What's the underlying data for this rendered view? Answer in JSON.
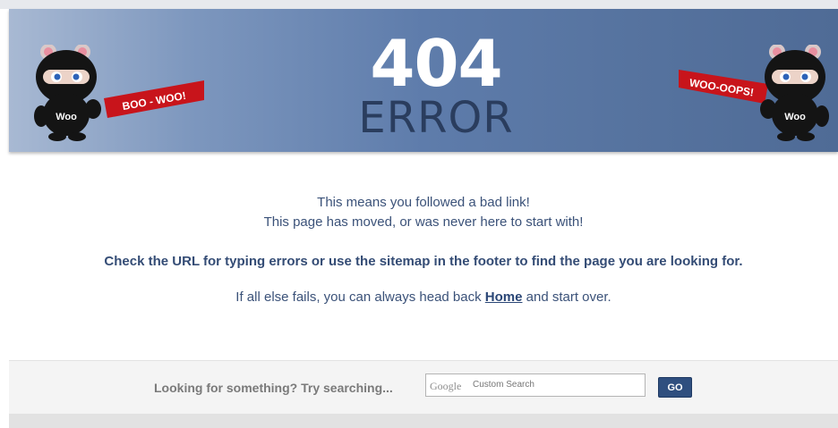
{
  "banner": {
    "title_number": "404",
    "title_word": "ERROR",
    "left_ribbon": "BOO - WOO!",
    "right_ribbon": "WOO-OOPS!",
    "mascot_label": "Woo"
  },
  "message": {
    "line1": "This means you followed a bad link!",
    "line2": "This page has moved, or was never here to start with!",
    "line3": "Check the URL for typing errors or use the sitemap in the footer to find the page you are looking for.",
    "line4_before": "If all else fails, you can always head back ",
    "home_link": "Home",
    "line4_after": " and start over."
  },
  "search": {
    "label": "Looking for something? Try searching...",
    "google_logo": "Google",
    "placeholder": "Custom Search",
    "go_label": "GO"
  },
  "colors": {
    "banner": "#5e7cab",
    "ribbon": "#c8141b",
    "text": "#3b5279",
    "go_button": "#2f4f7f"
  }
}
